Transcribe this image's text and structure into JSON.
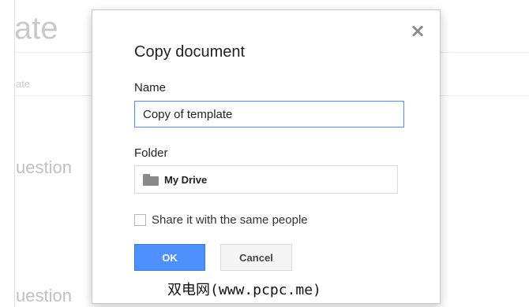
{
  "background": {
    "doc_title_fragment": "ate",
    "subtitle_fragment": "ate",
    "question_fragment_1": "uestion",
    "question_fragment_2": "uestion"
  },
  "dialog": {
    "title": "Copy document",
    "close_symbol": "×",
    "name_label": "Name",
    "name_value": "Copy of template",
    "folder_label": "Folder",
    "folder_value": "My Drive",
    "share_label": "Share it with the same people",
    "share_checked": false,
    "ok_label": "OK",
    "cancel_label": "Cancel"
  },
  "watermark": "双电网(www.pcpc.me)",
  "colors": {
    "primary_button": "#4d90fe",
    "input_focus_border": "#4d90fe",
    "icon_gray": "#8a8a8a"
  },
  "icons": [
    "close-icon",
    "folder-icon",
    "checkbox"
  ]
}
